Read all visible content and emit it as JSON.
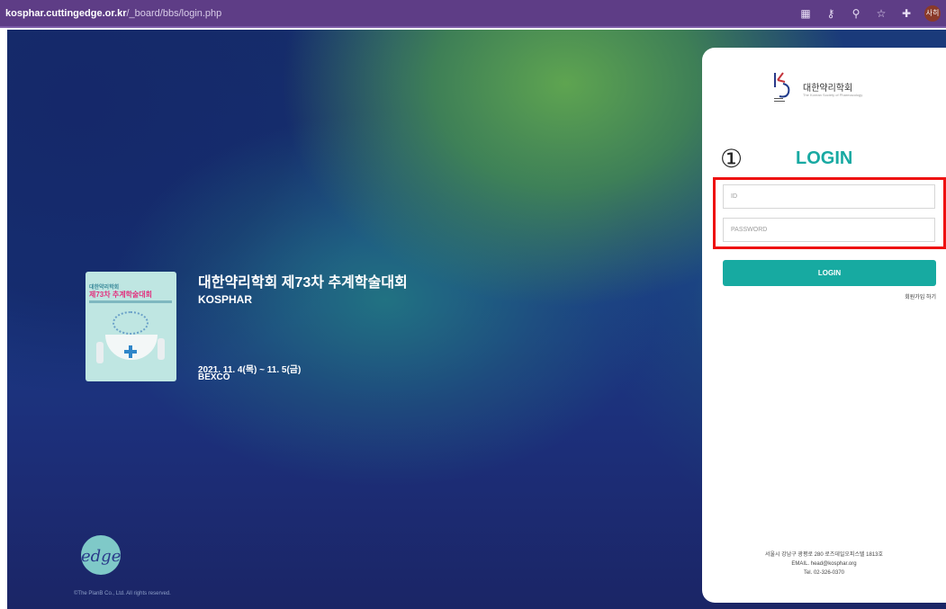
{
  "browser": {
    "url_host": "kosphar.cuttingedge.or.kr",
    "url_path": "/_board/bbs/login.php",
    "icons": [
      "qr-code-icon",
      "key-icon",
      "zoom-icon",
      "star-icon",
      "extensions-icon"
    ],
    "profile_label": "사히"
  },
  "event": {
    "poster_small_title": "대한약리학회",
    "poster_title": "제73차 추계학술대회",
    "title": "대한약리학회 제73차 추계학술대회",
    "org": "KOSPHAR",
    "date": "2021. 11. 4(목) ~ 11. 5(금)",
    "venue": "BEXCO"
  },
  "footer_left": {
    "logo_text": "edge",
    "copyright": "©The PlanB Co., Ltd. All rights reserved."
  },
  "login": {
    "society_name": "대한약리학회",
    "society_sub": "The Korean Society of Pharmacology",
    "heading": "LOGIN",
    "marker": "①",
    "id_placeholder": "ID",
    "password_placeholder": "PASSWORD",
    "button_label": "LOGIN",
    "signup_label": "회원가입 하기",
    "address": "서울시 강남구 광평로 280 로즈데일오피스텔 1813호",
    "email": "EMAIL. head@kosphar.org",
    "tel": "Tel. 02-326-0370"
  },
  "colors": {
    "accent": "#17aaa1",
    "highlight": "#ee1111",
    "browser_bar": "#5e3d86"
  }
}
